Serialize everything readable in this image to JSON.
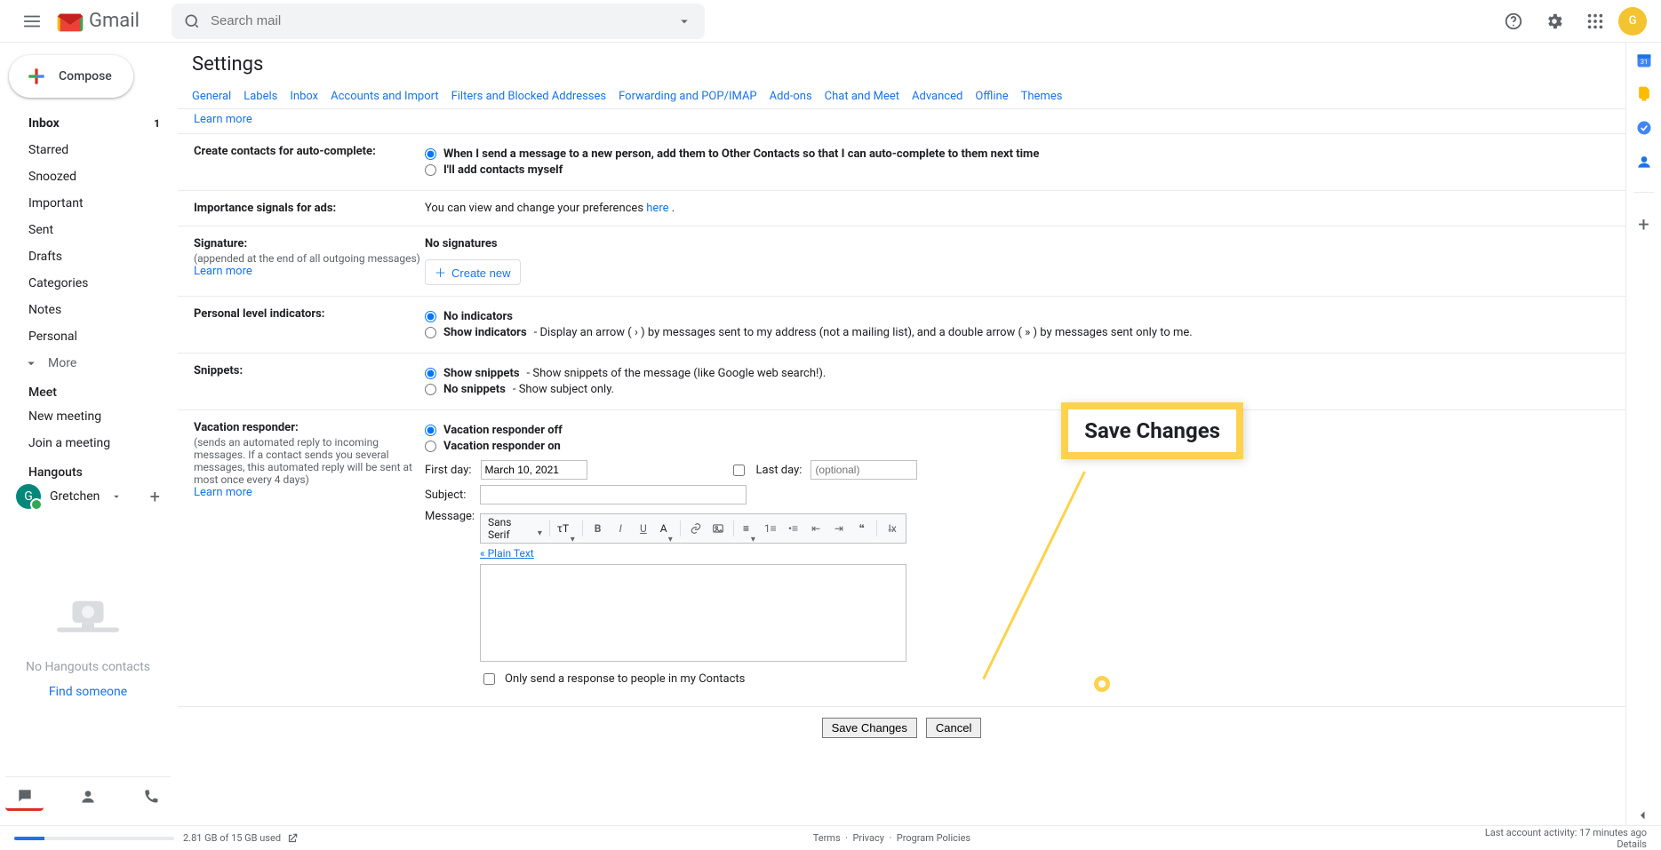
{
  "topbar": {
    "gmail_text": "Gmail",
    "search_placeholder": "Search mail",
    "avatar_letter": "G"
  },
  "sidebar": {
    "compose": "Compose",
    "items": [
      {
        "label": "Inbox",
        "badge": "1"
      },
      {
        "label": "Starred"
      },
      {
        "label": "Snoozed"
      },
      {
        "label": "Important"
      },
      {
        "label": "Sent"
      },
      {
        "label": "Drafts"
      },
      {
        "label": "Categories"
      },
      {
        "label": "Notes"
      },
      {
        "label": "Personal"
      }
    ],
    "more": "More",
    "meet_label": "Meet",
    "meet_items": [
      {
        "label": "New meeting"
      },
      {
        "label": "Join a meeting"
      }
    ],
    "hangouts_label": "Hangouts",
    "hangouts_name": "Gretchen",
    "hangouts_avatar_letter": "G",
    "empty1": "No Hangouts contacts",
    "empty2": "Find someone"
  },
  "settings": {
    "title": "Settings",
    "tabs": [
      "General",
      "Labels",
      "Inbox",
      "Accounts and Import",
      "Filters and Blocked Addresses",
      "Forwarding and POP/IMAP",
      "Add-ons",
      "Chat and Meet",
      "Advanced",
      "Offline",
      "Themes"
    ],
    "learn_more": "Learn more",
    "autocomplete": {
      "label": "Create contacts for auto-complete:",
      "opt1_a": "When I send a message to a new person, add them to Other Contacts so that I can auto-complete to them next time",
      "opt2_a": "I'll add contacts myself"
    },
    "ads": {
      "label": "Importance signals for ads:",
      "text_a": "You can view and change your preferences ",
      "text_link": "here",
      "text_b": "."
    },
    "signature": {
      "label": "Signature:",
      "sub": "(appended at the end of all outgoing messages)",
      "none": "No signatures",
      "create_new": "Create new"
    },
    "indicators": {
      "label": "Personal level indicators:",
      "opt1": "No indicators",
      "opt2_a": "Show indicators",
      "opt2_b": " - Display an arrow ( › ) by messages sent to my address (not a mailing list), and a double arrow ( » ) by messages sent only to me."
    },
    "snippets": {
      "label": "Snippets:",
      "opt1_a": "Show snippets",
      "opt1_b": " - Show snippets of the message (like Google web search!).",
      "opt2_a": "No snippets",
      "opt2_b": " - Show subject only."
    },
    "vacation": {
      "label": "Vacation responder:",
      "sub": "(sends an automated reply to incoming messages. If a contact sends you several messages, this automated reply will be sent at most once every 4 days)",
      "opt_off": "Vacation responder off",
      "opt_on": "Vacation responder on",
      "first_day": "First day:",
      "first_day_value": "March 10, 2021",
      "last_day": "Last day:",
      "last_day_placeholder": "(optional)",
      "subject": "Subject:",
      "message": "Message:",
      "toolbar_font": "Sans Serif",
      "plain_text": "« Plain Text",
      "only_contacts": "Only send a response to people in my Contacts"
    },
    "save": "Save Changes",
    "cancel": "Cancel",
    "callout": "Save Changes"
  },
  "footer": {
    "quota": "2.81 GB of 15 GB used",
    "center_a": "Terms",
    "center_b": "Privacy",
    "center_c": "Program Policies",
    "activity": "Last account activity: 17 minutes ago",
    "details": "Details"
  }
}
